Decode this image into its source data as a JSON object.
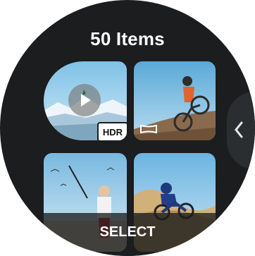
{
  "header": {
    "title": "50 Items"
  },
  "gallery": {
    "items": [
      {
        "kind": "video",
        "badge": "HDR",
        "subject": "snowy mountain scene with play overlay"
      },
      {
        "kind": "panorama",
        "subject": "mountain biker on a dirt hill"
      },
      {
        "kind": "photo",
        "subject": "person holding selfie stick with birds"
      },
      {
        "kind": "photo",
        "subject": "motocross rider in dust"
      }
    ]
  },
  "side_handle": {
    "icon": "chevron-left-icon"
  },
  "footer": {
    "select_label": "SELECT"
  },
  "colors": {
    "background": "#1b1d1f",
    "text": "#ffffff",
    "badge_bg": "#ffffff"
  }
}
